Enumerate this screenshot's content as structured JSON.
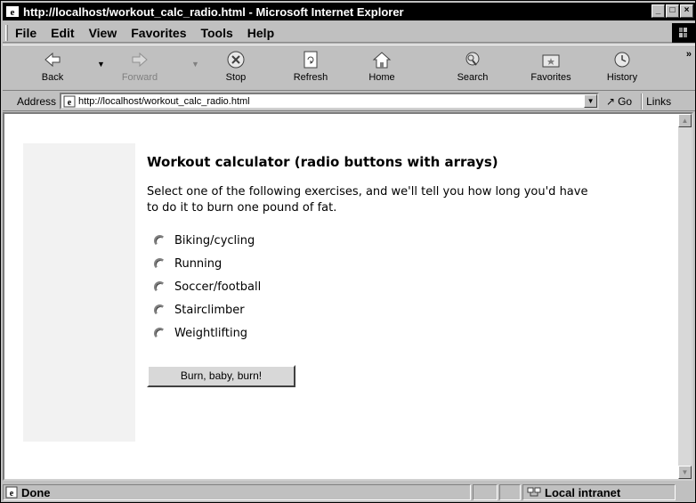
{
  "window": {
    "title": "http://localhost/workout_calc_radio.html - Microsoft Internet Explorer",
    "buttons": {
      "minimize": "_",
      "maximize": "□",
      "close": "×"
    }
  },
  "menu": {
    "file": "File",
    "edit": "Edit",
    "view": "View",
    "favorites": "Favorites",
    "tools": "Tools",
    "help": "Help"
  },
  "toolbar": {
    "back": "Back",
    "forward": "Forward",
    "stop": "Stop",
    "refresh": "Refresh",
    "home": "Home",
    "search": "Search",
    "favorites": "Favorites",
    "history": "History",
    "more": "»"
  },
  "address": {
    "label": "Address",
    "url": "http://localhost/workout_calc_radio.html",
    "go": "Go",
    "links": "Links"
  },
  "page": {
    "heading": "Workout calculator (radio buttons with arrays)",
    "intro": "Select one of the following exercises, and we'll tell you how long you'd have to do it to burn one pound of fat.",
    "options": [
      "Biking/cycling",
      "Running",
      "Soccer/football",
      "Stairclimber",
      "Weightlifting"
    ],
    "submit": "Burn, baby, burn!"
  },
  "status": {
    "text": "Done",
    "zone": "Local intranet"
  },
  "colors": {
    "chrome": "#c0c0c0",
    "titlebar": "#000000",
    "content_bg": "#ffffff",
    "panel": "#f2f2f2"
  }
}
